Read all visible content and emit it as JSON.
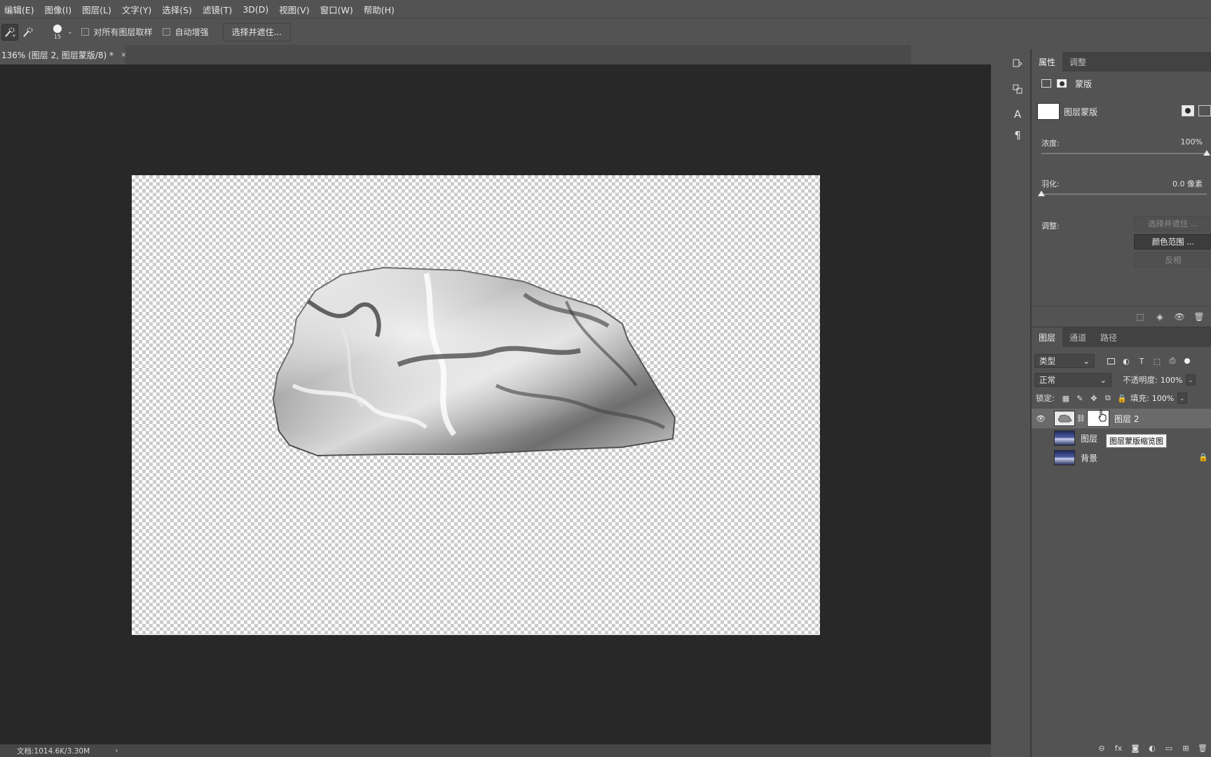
{
  "menubar": {
    "items": [
      "编辑(E)",
      "图像(I)",
      "图层(L)",
      "文字(Y)",
      "选择(S)",
      "滤镜(T)",
      "3D(D)",
      "视图(V)",
      "窗口(W)",
      "帮助(H)"
    ]
  },
  "options_bar": {
    "brush_size": "15",
    "sample_all_layers_label": "对所有图层取样",
    "auto_enhance_label": "自动增强",
    "select_mask_button": "选择并遮住..."
  },
  "document_tab": {
    "title": "136% (图层 2, 图层蒙版/8) *",
    "close": "×"
  },
  "status_bar": {
    "doc_info": "文档:1014.6K/3.30M",
    "arrow": "›"
  },
  "properties_panel": {
    "tabs": [
      "属性",
      "调整"
    ],
    "active_tab": "属性",
    "mask_type_label": "蒙版",
    "layer_mask_label": "图层蒙版",
    "density_label": "浓度:",
    "density_value": "100%",
    "density_level": 1.0,
    "feather_label": "羽化:",
    "feather_value": "0.0 像素",
    "feather_level": 0.0,
    "adjust_label": "调整:",
    "select_mask_button": "选择并遮住 ...",
    "color_range_button": "颜色范围 ...",
    "invert_button": "反相"
  },
  "layers_panel": {
    "tabs": [
      "图层",
      "通道",
      "路径"
    ],
    "active_tab": "图层",
    "filter_kind": "类型",
    "blend_mode": "正常",
    "opacity_label": "不透明度:",
    "opacity_value": "100%",
    "lock_label": "锁定:",
    "fill_label": "填充:",
    "fill_value": "100%",
    "layers": [
      {
        "name": "图层 2",
        "visible": true,
        "selected": true,
        "has_mask": true
      },
      {
        "name": "图层",
        "visible": false,
        "selected": false,
        "has_mask": false
      },
      {
        "name": "背景",
        "visible": false,
        "selected": false,
        "has_mask": false,
        "locked": true
      }
    ],
    "tooltip": "图层蒙版缩览图"
  },
  "colors": {
    "ui_bg": "#535353",
    "canvas_bg": "#282828",
    "selected_layer": "#6a6a6a"
  }
}
